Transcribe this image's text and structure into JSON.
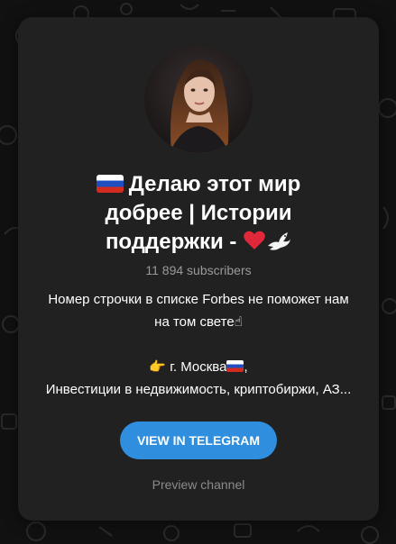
{
  "channel": {
    "title_line1": "Делаю этот мир",
    "title_line2": "добрее | Истории",
    "title_line3": "поддержки -",
    "subscribers": "11 894 subscribers",
    "description_line1": "Номер строчки в списке Forbes не поможет нам",
    "description_line2": "на том свете",
    "description_line3": "г. Москва",
    "description_line4": "Инвестиции в недвижимость, криптобиржи, АЗ..."
  },
  "actions": {
    "view_label": "VIEW IN TELEGRAM",
    "preview_label": "Preview channel"
  },
  "icons": {
    "flag": "russia-flag-icon",
    "heart": "red-heart-icon",
    "dove": "dove-icon",
    "pointing_up": "index-pointing-up-icon",
    "pointing_right": "backhand-pointing-right-icon"
  },
  "colors": {
    "card": "#212121",
    "button": "#2f8fde",
    "muted": "#9a9a9a"
  }
}
